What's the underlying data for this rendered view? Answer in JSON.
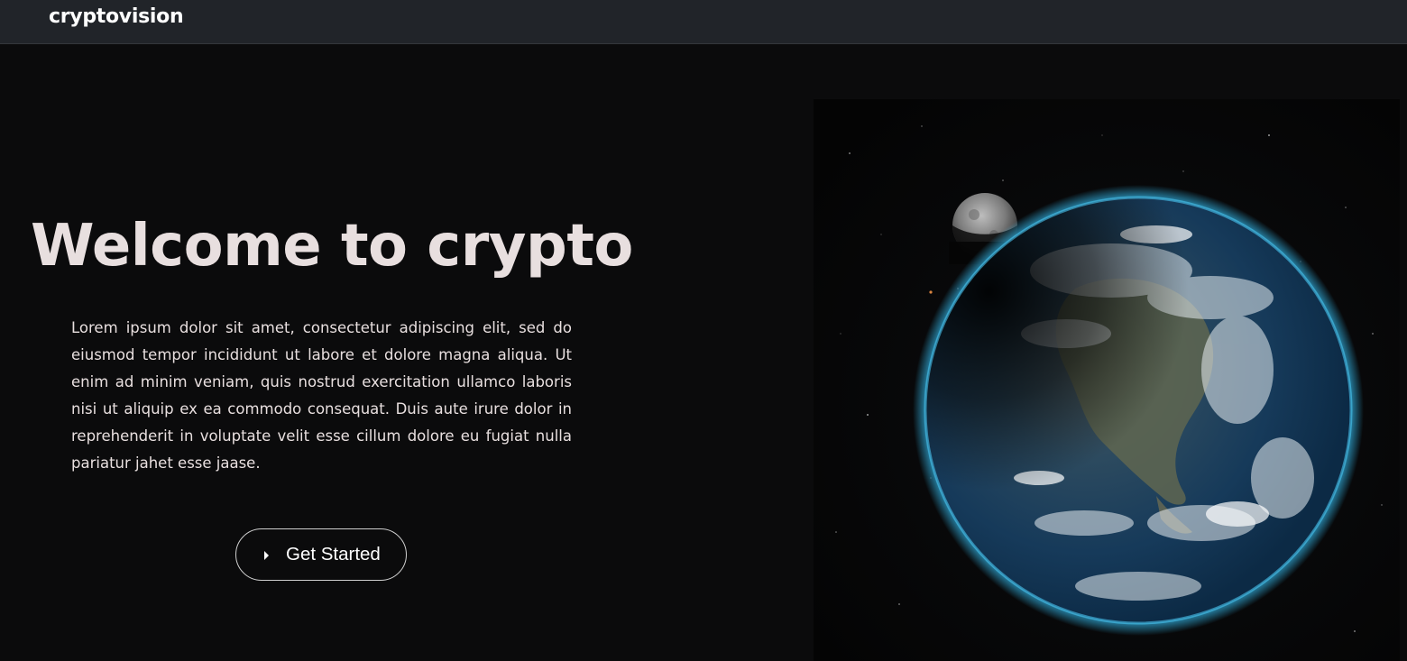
{
  "navbar": {
    "brand": "cryptovision"
  },
  "hero": {
    "title": "Welcome to crypto",
    "description": "Lorem ipsum dolor sit amet, consectetur adipiscing elit, sed do eiusmod tempor incididunt ut labore et dolore magna aliqua. Ut enim ad minim veniam, quis nostrud exercitation ullamco laboris nisi ut aliquip ex ea commodo consequat. Duis aute irure dolor in reprehenderit in voluptate velit esse cillum dolore eu fugiat nulla pariatur jahet esse jaase.",
    "cta_label": "Get Started",
    "cta_icon": "play-triangle-icon"
  },
  "image": {
    "subject": "earth-and-moon-image",
    "colors": {
      "background": "#0b0b0c",
      "navbar": "#212429",
      "text": "#e8dfdf",
      "atmosphere": "#38c8ff",
      "ocean": "#123a5c"
    }
  }
}
